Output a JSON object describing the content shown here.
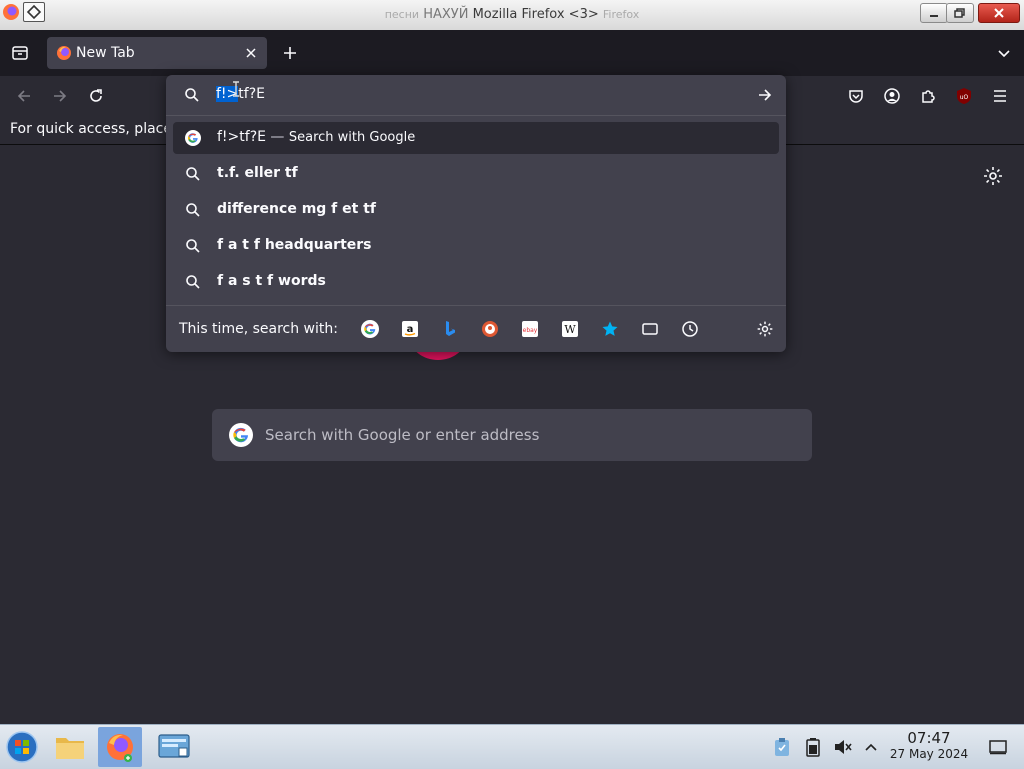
{
  "window": {
    "title": "Mozilla Firefox <3>",
    "title_ghost_left": "НАХУЙ",
    "title_ghost_right": "Firefox",
    "title_ghost_far_left": "песни"
  },
  "tabs": [
    {
      "label": "New Tab",
      "favicon": "firefox-icon",
      "active": true
    }
  ],
  "bookmarks_bar": {
    "text": "For quick access, place"
  },
  "urlbar": {
    "selected_text": "f!>",
    "rest_text": "tf?E",
    "results": [
      {
        "text": "f!>tf?E",
        "separator": "—",
        "subtext": "Search with Google",
        "icon": "google-icon"
      },
      {
        "text": "t.f. eller tf",
        "icon": "search-icon"
      },
      {
        "text": "difference mg f et tf",
        "icon": "search-icon"
      },
      {
        "text": "f a t f headquarters",
        "icon": "search-icon"
      },
      {
        "text": "f a s t f words",
        "icon": "search-icon"
      }
    ],
    "oneoff_label": "This time, search with:",
    "engines": [
      "google-icon",
      "amazon-icon",
      "bing-icon",
      "duckduckgo-icon",
      "ebay-icon",
      "wikipedia-icon",
      "bookmarks-star-icon",
      "tabs-icon",
      "history-icon"
    ]
  },
  "home": {
    "search_placeholder": "Search with Google or enter address"
  },
  "taskbar": {
    "time": "07:47",
    "date": "27 May 2024"
  },
  "colors": {
    "toolbar_bg": "#2b2a33",
    "tabstrip_bg": "#1c1b22",
    "popup_bg": "#42414d",
    "selection": "#0062d1",
    "accent_pink": "#e3145f"
  }
}
